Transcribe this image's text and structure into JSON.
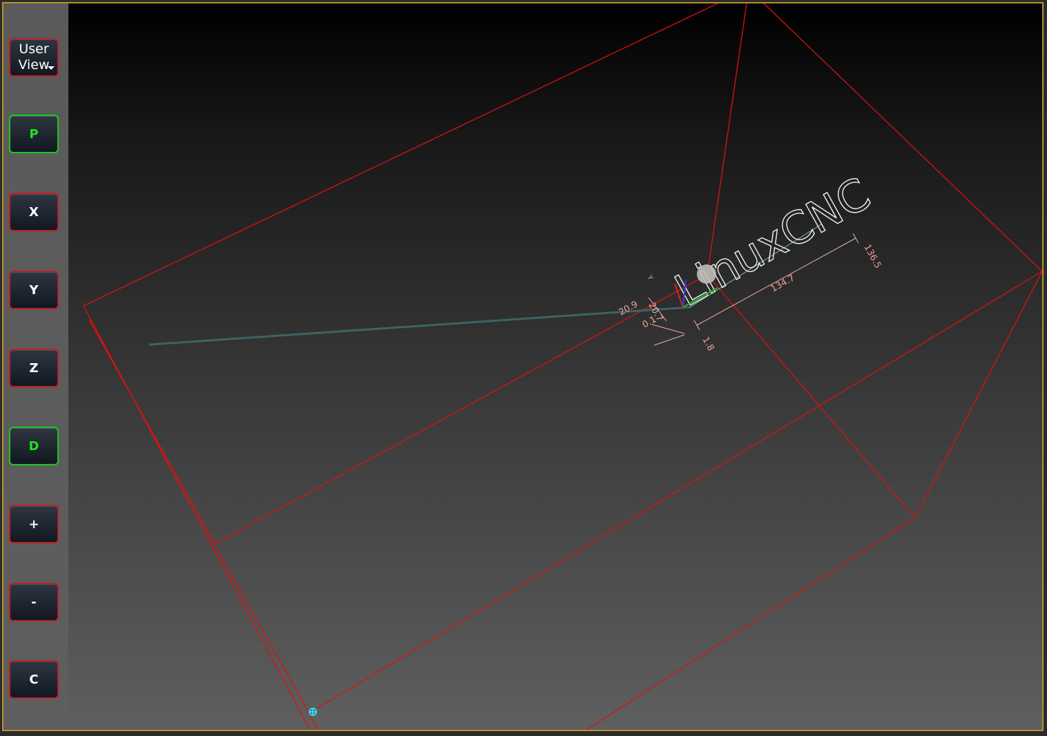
{
  "sidebar": {
    "user_view_line1": "User",
    "user_view_line2": "View",
    "buttons": {
      "p": "P",
      "x": "X",
      "y": "Y",
      "z": "Z",
      "d": "D",
      "zoom_in": "+",
      "zoom_out": "-",
      "clear": "C"
    },
    "active_buttons": [
      "P",
      "D"
    ]
  },
  "viewport": {
    "program_text": "LinuxCNC",
    "dimensions": {
      "length_x": "134.7",
      "length_y": "136.5",
      "x_min": "1.8",
      "y_small": "20.7",
      "y_max": "20.9",
      "z_small": "0.1",
      "y_axis_label": "Y"
    }
  },
  "colors": {
    "active_border": "#1ec81e",
    "inactive_border": "#c41c24",
    "limits_box": "#e01010",
    "frame_border": "#b8922e",
    "rapid_path": "#3c6464",
    "feed_path": "#ffffff",
    "dimension_text": "#f0a0a0"
  }
}
